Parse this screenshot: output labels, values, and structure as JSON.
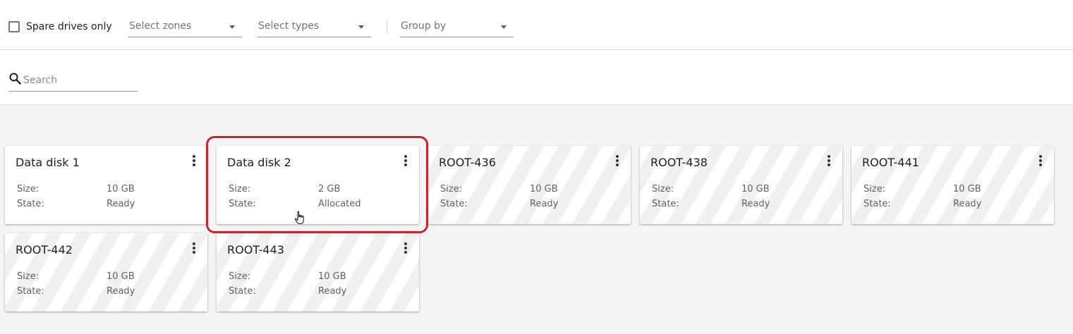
{
  "filters": {
    "spare_drives_label": "Spare drives only",
    "zones_placeholder": "Select zones",
    "types_placeholder": "Select types",
    "group_by_placeholder": "Group by"
  },
  "search": {
    "placeholder": "Search",
    "value": ""
  },
  "labels": {
    "size": "Size:",
    "state": "State:"
  },
  "disks": [
    {
      "name": "Data disk 1",
      "size": "10 GB",
      "state": "Ready",
      "striped": false
    },
    {
      "name": "Data disk 2",
      "size": "2 GB",
      "state": "Allocated",
      "striped": false
    },
    {
      "name": "ROOT-436",
      "size": "10 GB",
      "state": "Ready",
      "striped": true
    },
    {
      "name": "ROOT-438",
      "size": "10 GB",
      "state": "Ready",
      "striped": true
    },
    {
      "name": "ROOT-441",
      "size": "10 GB",
      "state": "Ready",
      "striped": true
    },
    {
      "name": "ROOT-442",
      "size": "10 GB",
      "state": "Ready",
      "striped": true
    },
    {
      "name": "ROOT-443",
      "size": "10 GB",
      "state": "Ready",
      "striped": true
    }
  ],
  "colors": {
    "highlight": "#c8242c",
    "stripe": "#f0f0f0"
  },
  "icons": {
    "search": "search-icon",
    "menu": "more-vertical-icon",
    "cursor": "hand-pointer-icon"
  }
}
